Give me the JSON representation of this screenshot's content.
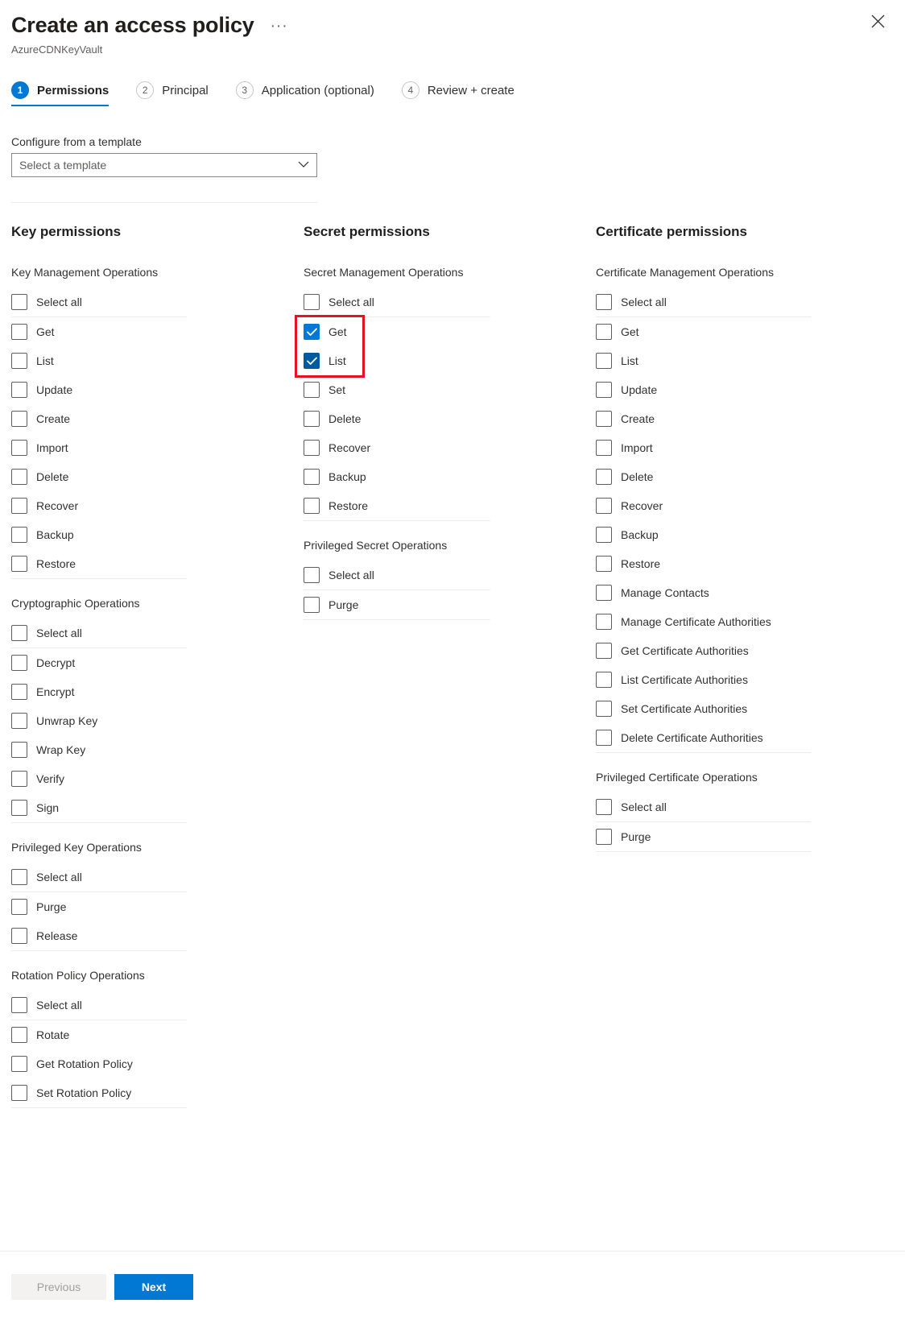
{
  "header": {
    "title": "Create an access policy",
    "subtitle": "AzureCDNKeyVault",
    "ellipsis": "···",
    "close_icon": "close-icon"
  },
  "tabs": [
    {
      "num": "1",
      "label": "Permissions",
      "active": true
    },
    {
      "num": "2",
      "label": "Principal",
      "active": false
    },
    {
      "num": "3",
      "label": "Application (optional)",
      "active": false
    },
    {
      "num": "4",
      "label": "Review + create",
      "active": false
    }
  ],
  "template": {
    "label": "Configure from a template",
    "value": "Select a template"
  },
  "columns": [
    {
      "key": "key",
      "title": "Key permissions",
      "groups": [
        {
          "title": "Key Management Operations",
          "select_all": {
            "label": "Select all",
            "checked": false
          },
          "items": [
            {
              "label": "Get",
              "checked": false
            },
            {
              "label": "List",
              "checked": false
            },
            {
              "label": "Update",
              "checked": false
            },
            {
              "label": "Create",
              "checked": false
            },
            {
              "label": "Import",
              "checked": false
            },
            {
              "label": "Delete",
              "checked": false
            },
            {
              "label": "Recover",
              "checked": false
            },
            {
              "label": "Backup",
              "checked": false
            },
            {
              "label": "Restore",
              "checked": false
            }
          ]
        },
        {
          "title": "Cryptographic Operations",
          "select_all": {
            "label": "Select all",
            "checked": false
          },
          "items": [
            {
              "label": "Decrypt",
              "checked": false
            },
            {
              "label": "Encrypt",
              "checked": false
            },
            {
              "label": "Unwrap Key",
              "checked": false
            },
            {
              "label": "Wrap Key",
              "checked": false
            },
            {
              "label": "Verify",
              "checked": false
            },
            {
              "label": "Sign",
              "checked": false
            }
          ]
        },
        {
          "title": "Privileged Key Operations",
          "select_all": {
            "label": "Select all",
            "checked": false
          },
          "items": [
            {
              "label": "Purge",
              "checked": false
            },
            {
              "label": "Release",
              "checked": false
            }
          ]
        },
        {
          "title": "Rotation Policy Operations",
          "select_all": {
            "label": "Select all",
            "checked": false
          },
          "items": [
            {
              "label": "Rotate",
              "checked": false
            },
            {
              "label": "Get Rotation Policy",
              "checked": false
            },
            {
              "label": "Set Rotation Policy",
              "checked": false
            }
          ]
        }
      ]
    },
    {
      "key": "secret",
      "title": "Secret permissions",
      "groups": [
        {
          "title": "Secret Management Operations",
          "select_all": {
            "label": "Select all",
            "checked": false
          },
          "items": [
            {
              "label": "Get",
              "checked": true,
              "pressed": false
            },
            {
              "label": "List",
              "checked": true,
              "pressed": true
            },
            {
              "label": "Set",
              "checked": false
            },
            {
              "label": "Delete",
              "checked": false
            },
            {
              "label": "Recover",
              "checked": false
            },
            {
              "label": "Backup",
              "checked": false
            },
            {
              "label": "Restore",
              "checked": false
            }
          ]
        },
        {
          "title": "Privileged Secret Operations",
          "select_all": {
            "label": "Select all",
            "checked": false
          },
          "items": [
            {
              "label": "Purge",
              "checked": false
            }
          ]
        }
      ]
    },
    {
      "key": "cert",
      "title": "Certificate permissions",
      "groups": [
        {
          "title": "Certificate Management Operations",
          "select_all": {
            "label": "Select all",
            "checked": false
          },
          "items": [
            {
              "label": "Get",
              "checked": false
            },
            {
              "label": "List",
              "checked": false
            },
            {
              "label": "Update",
              "checked": false
            },
            {
              "label": "Create",
              "checked": false
            },
            {
              "label": "Import",
              "checked": false
            },
            {
              "label": "Delete",
              "checked": false
            },
            {
              "label": "Recover",
              "checked": false
            },
            {
              "label": "Backup",
              "checked": false
            },
            {
              "label": "Restore",
              "checked": false
            },
            {
              "label": "Manage Contacts",
              "checked": false
            },
            {
              "label": "Manage Certificate Authorities",
              "checked": false
            },
            {
              "label": "Get Certificate Authorities",
              "checked": false
            },
            {
              "label": "List Certificate Authorities",
              "checked": false
            },
            {
              "label": "Set Certificate Authorities",
              "checked": false
            },
            {
              "label": "Delete Certificate Authorities",
              "checked": false
            }
          ]
        },
        {
          "title": "Privileged Certificate Operations",
          "select_all": {
            "label": "Select all",
            "checked": false
          },
          "items": [
            {
              "label": "Purge",
              "checked": false
            }
          ]
        }
      ]
    }
  ],
  "footer": {
    "previous_label": "Previous",
    "next_label": "Next"
  },
  "colors": {
    "accent": "#0078d4",
    "accent_pressed": "#005a9e",
    "highlight": "#e81123"
  }
}
